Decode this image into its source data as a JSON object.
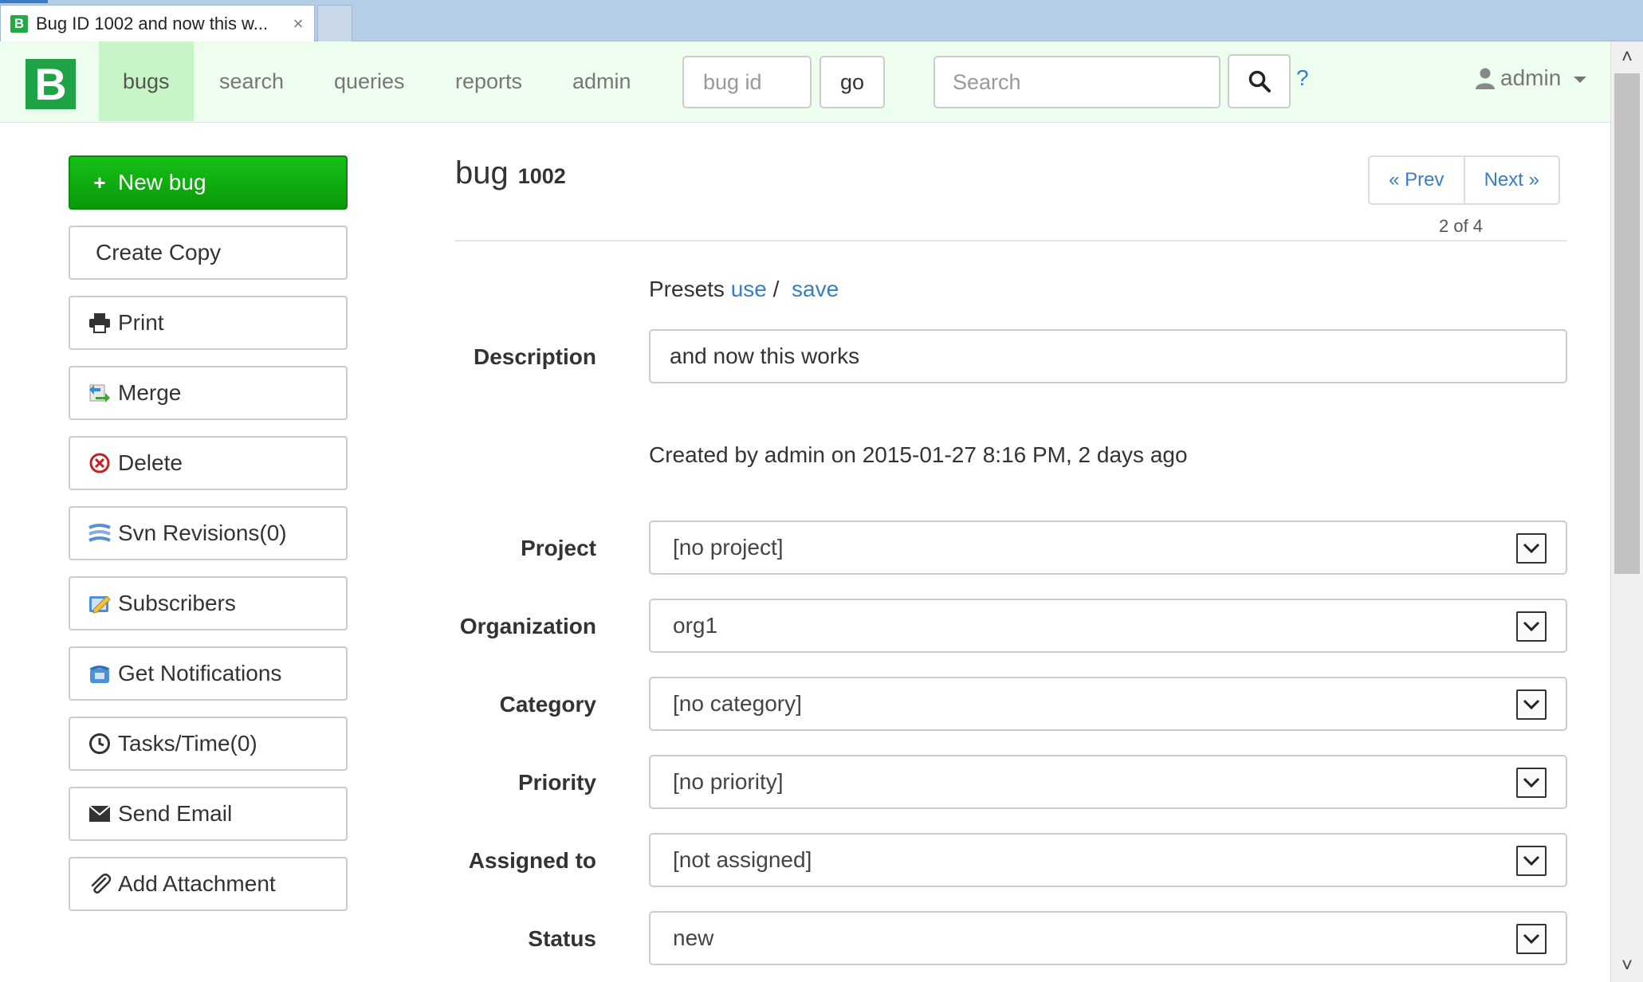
{
  "browser": {
    "tab_title": "Bug ID 1002 and now this w...",
    "favicon_letter": "B",
    "close_glyph": "×"
  },
  "navbar": {
    "brand_letter": "B",
    "links": [
      "bugs",
      "search",
      "queries",
      "reports",
      "admin"
    ],
    "active_link": "bugs",
    "bugid_placeholder": "bug id",
    "go_label": "go",
    "search_placeholder": "Search",
    "help_label": "?",
    "user_label": "admin"
  },
  "sidebar": {
    "new_bug": "New bug",
    "create_copy": "Create Copy",
    "print": "Print",
    "merge": "Merge",
    "delete": "Delete",
    "svn": "Svn Revisions(0)",
    "subscribers": "Subscribers",
    "notifications": "Get Notifications",
    "tasks": "Tasks/Time(0)",
    "email": "Send Email",
    "attachment": "Add Attachment"
  },
  "main": {
    "title_word": "bug",
    "bug_number": "1002",
    "prev_label": "« Prev",
    "next_label": "Next »",
    "position": "2 of 4",
    "presets_label": "Presets",
    "presets_use": "use",
    "presets_sep": "/",
    "presets_save": "save",
    "description_label": "Description",
    "description_value": "and now this works",
    "created_text": "Created by admin on 2015-01-27 8:16 PM, 2 days ago",
    "fields": {
      "project": {
        "label": "Project",
        "value": "[no project]"
      },
      "organization": {
        "label": "Organization",
        "value": "org1"
      },
      "category": {
        "label": "Category",
        "value": "[no category]"
      },
      "priority": {
        "label": "Priority",
        "value": "[no priority]"
      },
      "assigned": {
        "label": "Assigned to",
        "value": "[not assigned]"
      },
      "status": {
        "label": "Status",
        "value": "new"
      }
    }
  },
  "colors": {
    "brand_green": "#20a346",
    "navbar_bg": "#eefeee",
    "active_tab_bg": "#c7f5c7",
    "primary_button": "#0fae0f",
    "link_blue": "#3a7ec2"
  },
  "icons": [
    "plus-icon",
    "printer-icon",
    "merge-icon",
    "delete-icon",
    "svn-icon",
    "subscribers-icon",
    "notifications-icon",
    "clock-icon",
    "envelope-icon",
    "paperclip-icon",
    "search-icon",
    "user-icon"
  ]
}
